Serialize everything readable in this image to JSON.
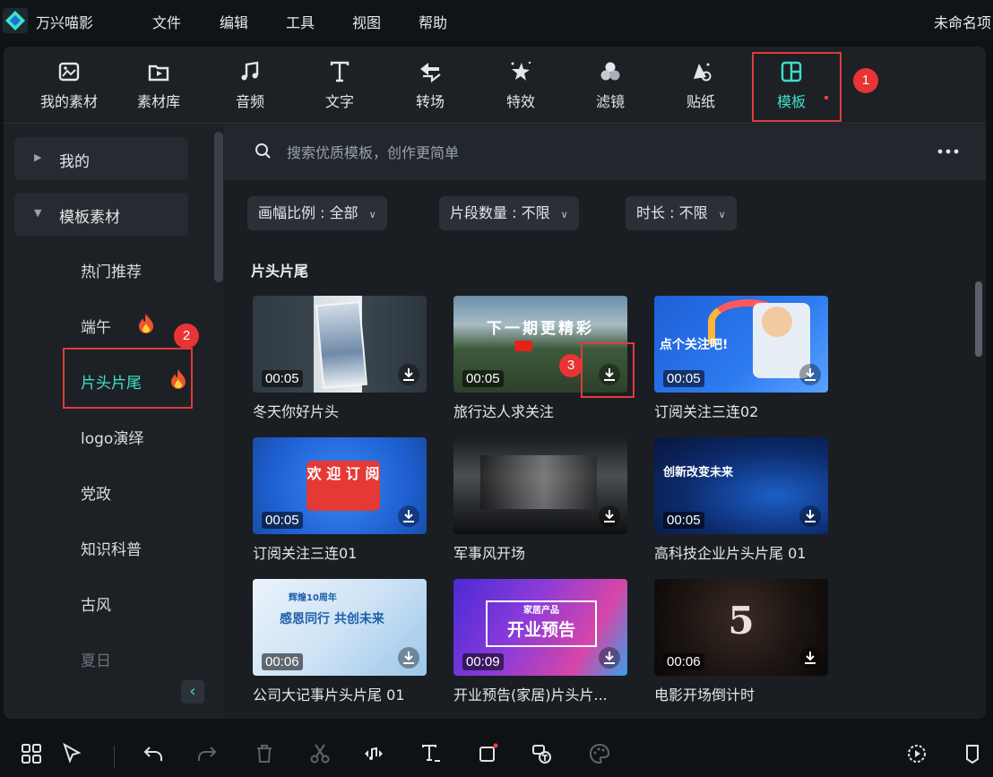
{
  "app": {
    "name": "万兴喵影",
    "project_name": "未命名项"
  },
  "menu": [
    "文件",
    "编辑",
    "工具",
    "视图",
    "帮助"
  ],
  "toolbar": [
    {
      "label": "我的素材",
      "icon": "my-media-icon"
    },
    {
      "label": "素材库",
      "icon": "stock-library-icon"
    },
    {
      "label": "音频",
      "icon": "audio-icon"
    },
    {
      "label": "文字",
      "icon": "text-icon"
    },
    {
      "label": "转场",
      "icon": "transition-icon"
    },
    {
      "label": "特效",
      "icon": "effects-icon"
    },
    {
      "label": "滤镜",
      "icon": "filter-icon"
    },
    {
      "label": "贴纸",
      "icon": "sticker-icon"
    },
    {
      "label": "模板",
      "icon": "template-icon",
      "active": true
    }
  ],
  "annotations": [
    "1",
    "2",
    "3"
  ],
  "sidebar": {
    "groups": [
      {
        "label": "我的",
        "expanded": false
      },
      {
        "label": "模板素材",
        "expanded": true
      }
    ],
    "items": [
      {
        "label": "热门推荐"
      },
      {
        "label": "端午",
        "hot": true
      },
      {
        "label": "片头片尾",
        "hot": true,
        "active": true
      },
      {
        "label": "logo演绎"
      },
      {
        "label": "党政"
      },
      {
        "label": "知识科普"
      },
      {
        "label": "古风"
      },
      {
        "label": "夏日"
      }
    ],
    "collapse_label": "‹"
  },
  "search": {
    "placeholder": "搜索优质模板，创作更简单"
  },
  "filters": [
    {
      "label": "画幅比例 : 全部"
    },
    {
      "label": "片段数量 : 不限"
    },
    {
      "label": "时长 : 不限"
    }
  ],
  "section_title": "片头片尾",
  "templates": [
    {
      "title": "冬天你好片头",
      "duration": "00:05"
    },
    {
      "title": "旅行达人求关注",
      "duration": "00:05",
      "overlay_text": "下一期更精彩"
    },
    {
      "title": "订阅关注三连02",
      "duration": "00:05",
      "overlay_text": "点个关注吧!"
    },
    {
      "title": "订阅关注三连01",
      "duration": "00:05",
      "overlay_text": "欢 迎 订 阅"
    },
    {
      "title": "军事风开场",
      "duration": ""
    },
    {
      "title": "高科技企业片头片尾 01",
      "duration": "00:05",
      "overlay_text": "创新改变未来"
    },
    {
      "title": "公司大记事片头片尾 01",
      "duration": "00:06",
      "overlay_text": "感恩同行  共创未来",
      "overlay_sub": "辉煌10周年"
    },
    {
      "title": "开业预告(家居)片头片...",
      "duration": "00:09",
      "overlay_text": "开业预告",
      "overlay_sub": "家居产品"
    },
    {
      "title": "电影开场倒计时",
      "duration": "00:06",
      "overlay_text": "5"
    }
  ],
  "colors": {
    "accent": "#3ee0c6",
    "annotation": "#e83434",
    "background": "#1d2126"
  }
}
